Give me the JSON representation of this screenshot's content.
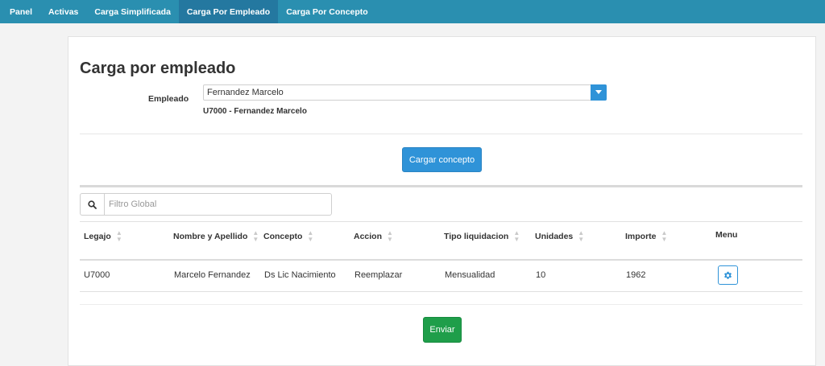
{
  "nav": {
    "items": [
      {
        "label": "Panel"
      },
      {
        "label": "Activas"
      },
      {
        "label": "Carga Simplificada"
      },
      {
        "label": "Carga Por Empleado"
      },
      {
        "label": "Carga Por Concepto"
      }
    ],
    "active_index": 3
  },
  "page": {
    "title": "Carga por empleado"
  },
  "employee": {
    "label": "Empleado",
    "selected": "Fernandez Marcelo",
    "code_line": "U7000 - Fernandez Marcelo"
  },
  "actions": {
    "cargar_label": "Cargar concepto",
    "enviar_label": "Enviar"
  },
  "filter": {
    "placeholder": "Filtro Global",
    "value": ""
  },
  "table": {
    "columns": [
      {
        "label": "Legajo",
        "sortable": true
      },
      {
        "label": "Nombre y Apellido",
        "sortable": true
      },
      {
        "label": "Concepto",
        "sortable": true
      },
      {
        "label": "Accion",
        "sortable": true
      },
      {
        "label": "Tipo liquidacion",
        "sortable": true
      },
      {
        "label": "Unidades",
        "sortable": true
      },
      {
        "label": "Importe",
        "sortable": true
      },
      {
        "label": "Menu",
        "sortable": false
      }
    ],
    "rows": [
      [
        "U7000",
        "Marcelo Fernandez",
        "Ds Lic Nacimiento",
        "Reemplazar",
        "Mensualidad",
        "10",
        "1962"
      ]
    ]
  },
  "colors": {
    "nav_bg": "#2a8fb0",
    "nav_active": "#2478a0",
    "primary": "#2f93d8",
    "success": "#1f9e4a"
  },
  "icons": {
    "dropdown": "caret-down-icon",
    "search": "search-icon",
    "menu": "gear-icon",
    "sort": "sort-icon"
  }
}
